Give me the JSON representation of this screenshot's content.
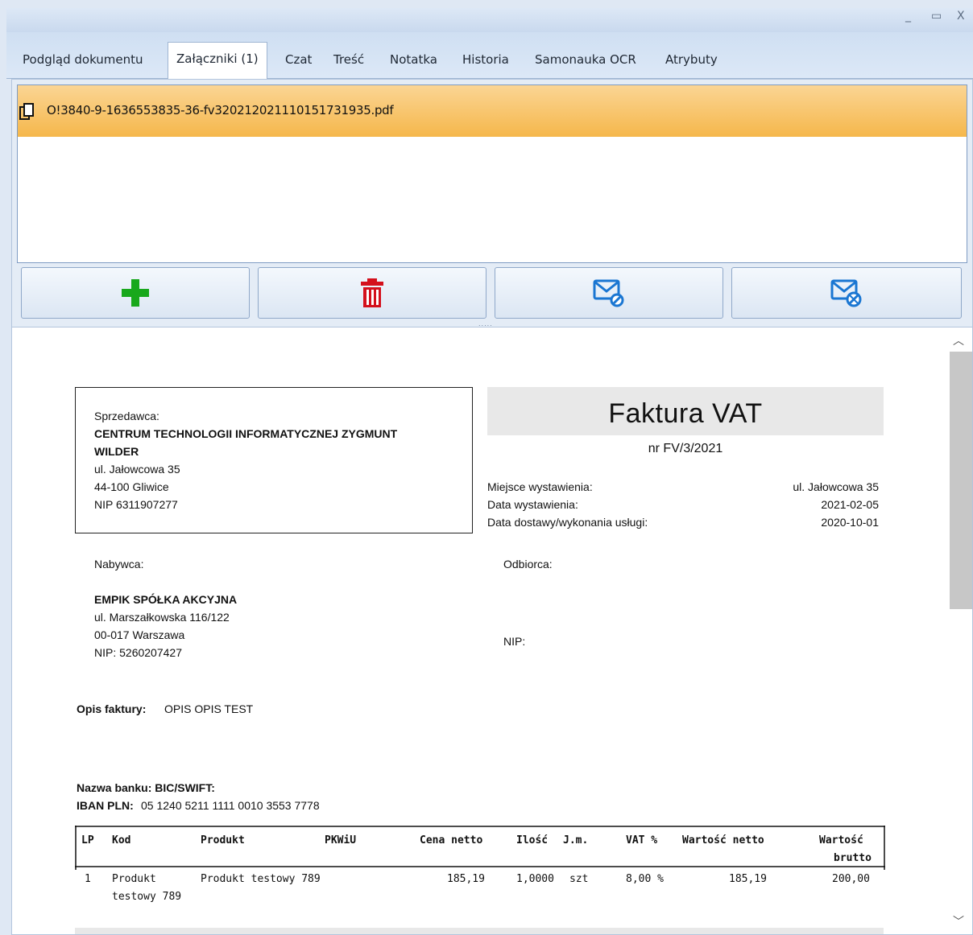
{
  "window": {
    "minimize": "_",
    "maximize": "▭",
    "close": "X"
  },
  "tabs": [
    {
      "label": "Podgląd dokumentu"
    },
    {
      "label": "Załączniki (1)"
    },
    {
      "label": "Czat"
    },
    {
      "label": "Treść"
    },
    {
      "label": "Notatka"
    },
    {
      "label": "Historia"
    },
    {
      "label": "Samonauka OCR"
    },
    {
      "label": "Atrybuty"
    }
  ],
  "attachments": {
    "items": [
      {
        "name": "O!3840-9-1636553835-36-fv320212021110151731935.pdf"
      }
    ],
    "selected_color": "#f5b74b"
  },
  "toolbar": {
    "add_icon": "plus-icon",
    "delete_icon": "trash-icon",
    "send_icon": "mail-send-icon",
    "resend_icon": "mail-resend-icon",
    "splitter": "....."
  },
  "invoice": {
    "seller_label": "Sprzedawca:",
    "seller_name_1": "CENTRUM TECHNOLOGII INFORMATYCZNEJ ZYGMUNT",
    "seller_name_2": "WILDER",
    "seller_street": "ul. Jałowcowa 35",
    "seller_city": "44-100 Gliwice",
    "seller_nip": "NIP 6311907277",
    "title": "Faktura VAT",
    "number": "nr FV/3/2021",
    "place_label": "Miejsce wystawienia:",
    "place_value": "ul. Jałowcowa 35",
    "issue_label": "Data wystawienia:",
    "issue_value": "2021-02-05",
    "delivery_label": "Data dostawy/wykonania usługi:",
    "delivery_value": "2020-10-01",
    "buyer_label": "Nabywca:",
    "buyer_name": "EMPIK SPÓŁKA AKCYJNA",
    "buyer_street": "ul. Marszałkowska 116/122",
    "buyer_city": "00-017 Warszawa",
    "buyer_nip": "NIP: 5260207427",
    "receiver_label": "Odbiorca:",
    "receiver_nip": "NIP:",
    "desc_label": "Opis faktury:",
    "desc_value": "OPIS OPIS TEST",
    "bank_line": "Nazwa banku:  BIC/SWIFT:",
    "iban_label": "IBAN PLN:",
    "iban_value": "05 1240 5211 1111 0010 3553 7778"
  },
  "table": {
    "headers": {
      "lp": "LP",
      "kod": "Kod",
      "produkt": "Produkt",
      "pkwiu": "PKWiU",
      "cena": "Cena netto",
      "ilosc": "Ilość",
      "jm": "J.m.",
      "vat": "VAT %",
      "netto": "Wartość netto",
      "brutto_1": "Wartość",
      "brutto_2": "brutto"
    },
    "rows": [
      {
        "lp": "1",
        "kod_1": "Produkt",
        "kod_2": "testowy 789",
        "produkt": "Produkt testowy 789",
        "pkwiu": "",
        "cena": "185,19",
        "ilosc": "1,0000",
        "jm": "szt",
        "vat": "8,00 %",
        "netto": "185,19",
        "brutto": "200,00"
      }
    ]
  }
}
